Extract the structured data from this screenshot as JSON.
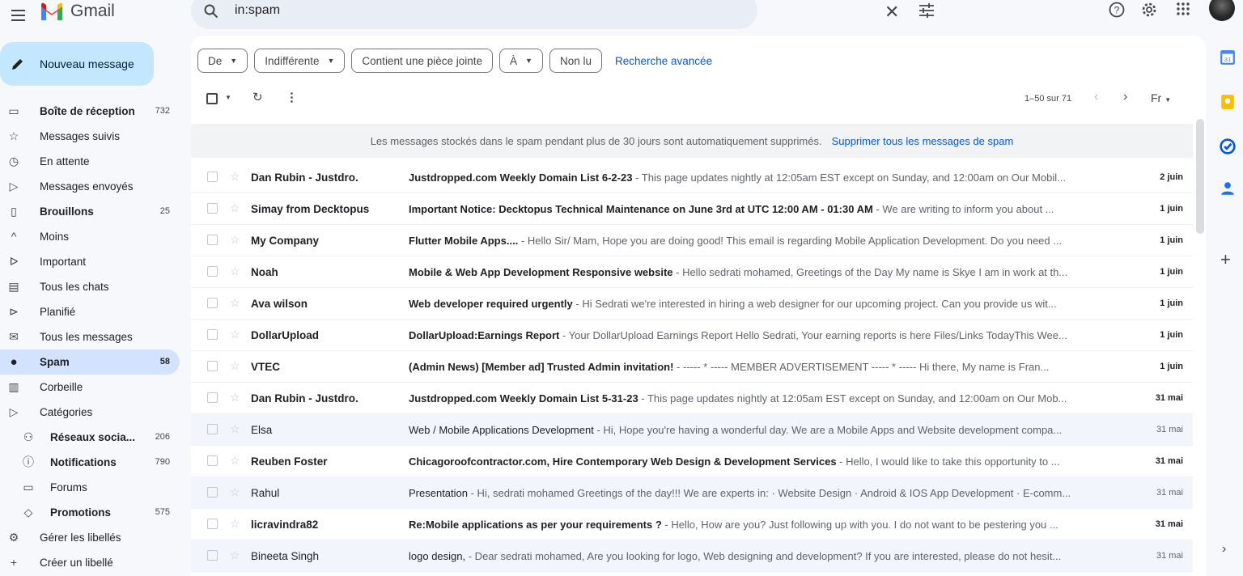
{
  "app": {
    "name": "Gmail"
  },
  "search": {
    "value": "in:spam"
  },
  "compose": {
    "label": "Nouveau message"
  },
  "nav": [
    {
      "label": "Boîte de réception",
      "count": "732",
      "icon": "inbox-icon",
      "bold": true,
      "active": false
    },
    {
      "label": "Messages suivis",
      "count": "",
      "icon": "star-icon",
      "bold": false,
      "active": false
    },
    {
      "label": "En attente",
      "count": "",
      "icon": "clock-icon",
      "bold": false,
      "active": false
    },
    {
      "label": "Messages envoyés",
      "count": "",
      "icon": "send-icon",
      "bold": false,
      "active": false
    },
    {
      "label": "Brouillons",
      "count": "25",
      "icon": "draft-icon",
      "bold": true,
      "active": false
    },
    {
      "label": "Moins",
      "count": "",
      "icon": "chevron-up-icon",
      "bold": false,
      "active": false
    },
    {
      "label": "Important",
      "count": "",
      "icon": "important-icon",
      "bold": false,
      "active": false
    },
    {
      "label": "Tous les chats",
      "count": "",
      "icon": "chat-icon",
      "bold": false,
      "active": false
    },
    {
      "label": "Planifié",
      "count": "",
      "icon": "scheduled-icon",
      "bold": false,
      "active": false
    },
    {
      "label": "Tous les messages",
      "count": "",
      "icon": "all-mail-icon",
      "bold": false,
      "active": false
    },
    {
      "label": "Spam",
      "count": "58",
      "icon": "spam-icon",
      "bold": true,
      "active": true
    },
    {
      "label": "Corbeille",
      "count": "",
      "icon": "trash-icon",
      "bold": false,
      "active": false
    },
    {
      "label": "Catégories",
      "count": "",
      "icon": "label-icon",
      "bold": false,
      "active": false
    },
    {
      "label": "Réseaux socia...",
      "count": "206",
      "icon": "social-icon",
      "bold": true,
      "active": false,
      "sub": true
    },
    {
      "label": "Notifications",
      "count": "790",
      "icon": "info-icon",
      "bold": true,
      "active": false,
      "sub": true
    },
    {
      "label": "Forums",
      "count": "",
      "icon": "forum-icon",
      "bold": false,
      "active": false,
      "sub": true
    },
    {
      "label": "Promotions",
      "count": "575",
      "icon": "tag-icon",
      "bold": true,
      "active": false,
      "sub": true
    },
    {
      "label": "Gérer les libellés",
      "count": "",
      "icon": "gear-icon",
      "bold": false,
      "active": false
    },
    {
      "label": "Créer un libellé",
      "count": "",
      "icon": "plus-icon",
      "bold": false,
      "active": false
    }
  ],
  "filters": {
    "from": "De",
    "time": "Indifférente",
    "attachment": "Contient une pièce jointe",
    "to": "À",
    "unread": "Non lu",
    "advanced": "Recherche avancée"
  },
  "toolbar": {
    "pagination": "1–50 sur 71",
    "input_lang": "Fr"
  },
  "banner": {
    "text": "Les messages stockés dans le spam pendant plus de 30 jours sont automatiquement supprimés.",
    "link": "Supprimer tous les messages de spam"
  },
  "emails": [
    {
      "sender": "Dan Rubin - Justdro.",
      "subject": "Justdropped.com Weekly Domain List 6-2-23",
      "snippet": " - This page updates nightly at 12:05am EST except on Sunday, and 12:00am on Our Mobil...",
      "date": "2 juin",
      "unread": true
    },
    {
      "sender": "Simay from Decktopus",
      "subject": "Important Notice: Decktopus Technical Maintenance on June 3rd at UTC 12:00 AM - 01:30 AM",
      "snippet": " - We are writing to inform you about ...",
      "date": "1 juin",
      "unread": true
    },
    {
      "sender": "My Company",
      "subject": "Flutter Mobile Apps....",
      "snippet": " - Hello Sir/ Mam, Hope you are doing good! This email is regarding Mobile Application Development. Do you need ...",
      "date": "1 juin",
      "unread": true
    },
    {
      "sender": "Noah",
      "subject": "Mobile & Web App Development Responsive website",
      "snippet": " - Hello sedrati mohamed, Greetings of the Day My name is Skye I am in work at th...",
      "date": "1 juin",
      "unread": true
    },
    {
      "sender": "Ava wilson",
      "subject": "Web developer required urgently",
      "snippet": " - Hi Sedrati we're interested in hiring a web designer for our upcoming project. Can you provide us wit...",
      "date": "1 juin",
      "unread": true
    },
    {
      "sender": "DollarUpload",
      "subject": "DollarUpload:Earnings Report",
      "snippet": " - Your DollarUpload Earnings Report Hello Sedrati, Your earning reports is here Files/Links TodayThis Wee...",
      "date": "1 juin",
      "unread": true
    },
    {
      "sender": "VTEC",
      "subject": "(Admin News) [Member ad] Trusted Admin invitation!",
      "snippet": " - ----- * ----- MEMBER ADVERTISEMENT ----- * ----- Hi there, My name is Fran...",
      "date": "1 juin",
      "unread": true
    },
    {
      "sender": "Dan Rubin - Justdro.",
      "subject": "Justdropped.com Weekly Domain List 5-31-23",
      "snippet": " - This page updates nightly at 12:05am EST except on Sunday, and 12:00am on Our Mob...",
      "date": "31 mai",
      "unread": true
    },
    {
      "sender": "Elsa",
      "subject": "Web / Mobile Applications Development",
      "snippet": " - Hi, Hope you're having a wonderful day. We are a Mobile Apps and Website development compa...",
      "date": "31 mai",
      "unread": false
    },
    {
      "sender": "Reuben Foster",
      "subject": "Chicagoroofcontractor.com, Hire Contemporary Web Design & Development Services",
      "snippet": " - Hello, I would like to take this opportunity to ...",
      "date": "31 mai",
      "unread": true
    },
    {
      "sender": "Rahul",
      "subject": "Presentation",
      "snippet": " - Hi, sedrati mohamed Greetings of the day!!! We are experts in: · Website Design · Android & IOS App Development · E-comm...",
      "date": "31 mai",
      "unread": false
    },
    {
      "sender": "licravindra82",
      "subject": "Re:Mobile applications as per your requirements ?",
      "snippet": " - Hello, How are you? Just following up with you. I do not want to be pestering you ...",
      "date": "31 mai",
      "unread": true
    },
    {
      "sender": "Bineeta Singh",
      "subject": "logo design,",
      "snippet": " - Dear sedrati mohamed, Are you looking for logo, Web designing and development? If you are interested, please do not hesit...",
      "date": "31 mai",
      "unread": false
    }
  ],
  "colors": {
    "accent": "#0b57d0",
    "compose_bg": "#c2e7ff",
    "active_nav": "#d3e3fd",
    "page_bg": "#f6f8fc",
    "gmail_red": "#ea4335",
    "gmail_blue": "#4285f4",
    "gmail_green": "#34a853",
    "gmail_yellow": "#fbbc04"
  }
}
